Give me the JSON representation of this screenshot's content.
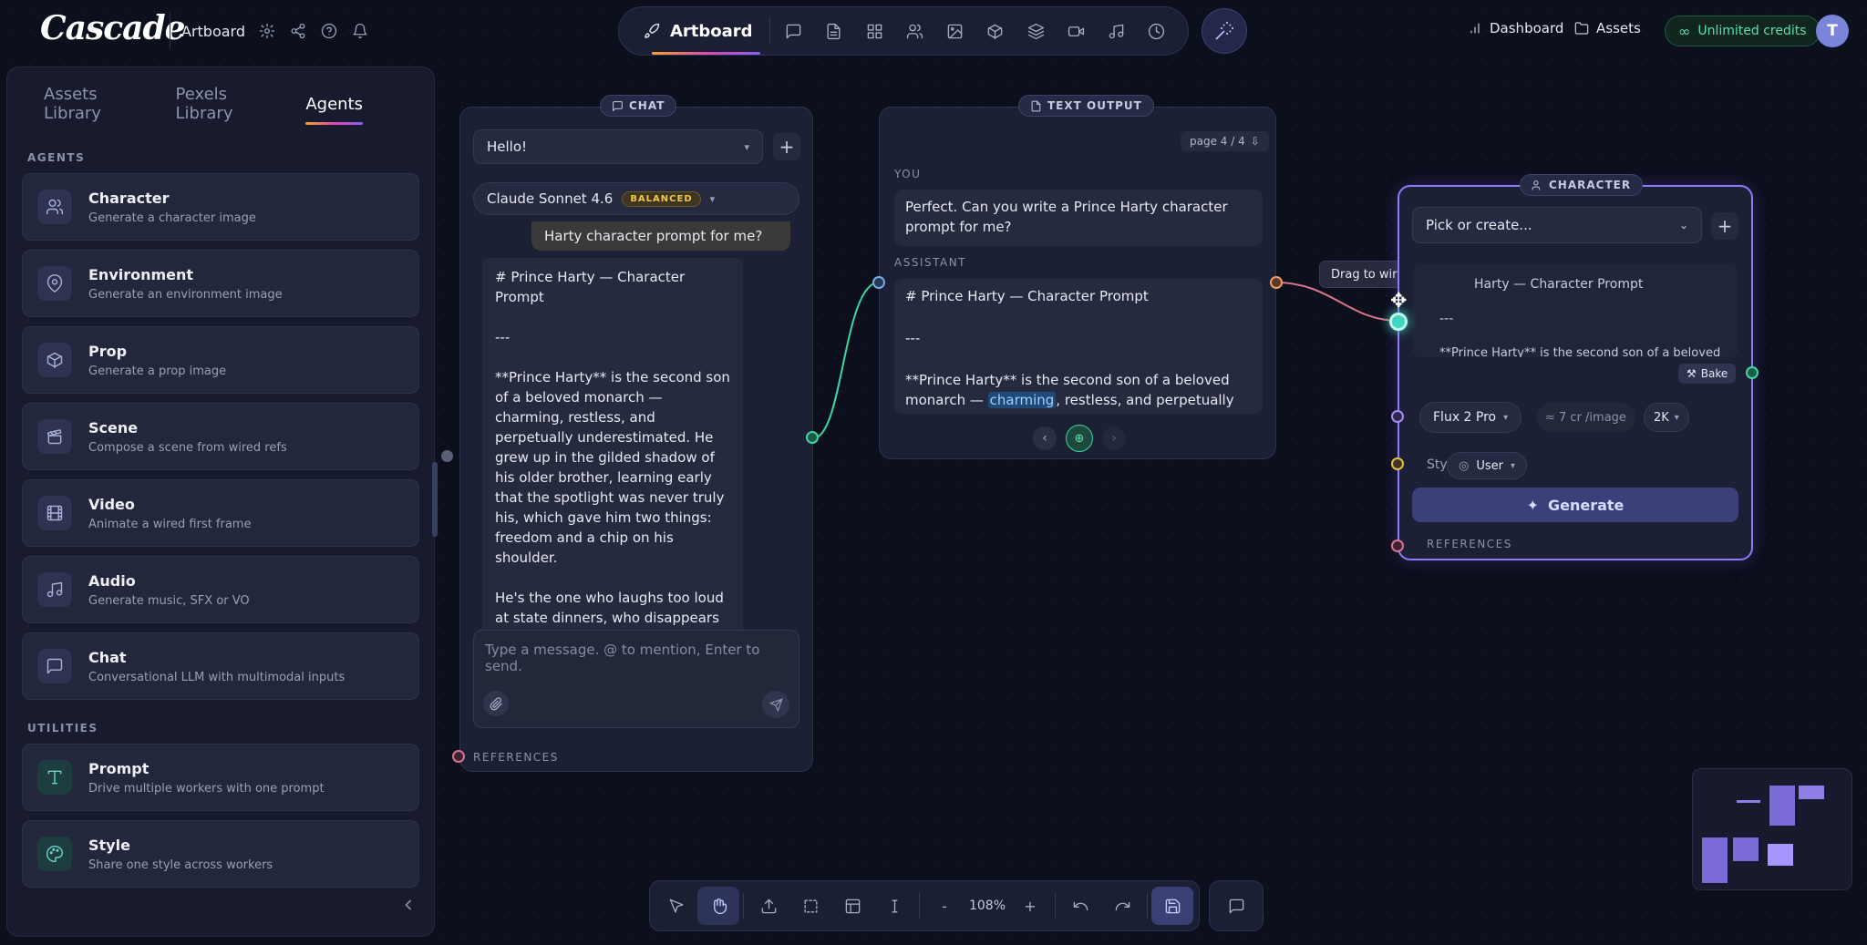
{
  "app": {
    "logo": "Cascade",
    "project_name": "Artboard"
  },
  "toolbar": {
    "active_tool": "Artboard"
  },
  "header": {
    "dashboard": "Dashboard",
    "assets": "Assets",
    "credits": "Unlimited credits",
    "avatar": "T"
  },
  "sidebar": {
    "tabs": [
      "Assets Library",
      "Pexels Library",
      "Agents"
    ],
    "agents_heading": "AGENTS",
    "agents": [
      {
        "name": "Character",
        "desc": "Generate a character image",
        "icon": "users-icon"
      },
      {
        "name": "Environment",
        "desc": "Generate an environment image",
        "icon": "map-pin-icon"
      },
      {
        "name": "Prop",
        "desc": "Generate a prop image",
        "icon": "cube-icon"
      },
      {
        "name": "Scene",
        "desc": "Compose a scene from wired refs",
        "icon": "clapper-icon"
      },
      {
        "name": "Video",
        "desc": "Animate a wired first frame",
        "icon": "film-icon"
      },
      {
        "name": "Audio",
        "desc": "Generate music, SFX or VO",
        "icon": "music-icon"
      },
      {
        "name": "Chat",
        "desc": "Conversational LLM with multimodal inputs",
        "icon": "chat-icon"
      }
    ],
    "utilities_heading": "UTILITIES",
    "utilities": [
      {
        "name": "Prompt",
        "desc": "Drive multiple workers with one prompt",
        "icon": "text-icon"
      },
      {
        "name": "Style",
        "desc": "Share one style across workers",
        "icon": "palette-icon"
      }
    ]
  },
  "chat_node": {
    "badge": "CHAT",
    "session": "Hello!",
    "model": "Claude Sonnet 4.6",
    "model_badge": "BALANCED",
    "user_msg": "Harty character prompt for me?",
    "assistant_msg": "# Prince Harty — Character Prompt\n\n---\n\n**Prince Harty** is the second son of a beloved monarch — charming, restless, and perpetually underestimated. He grew up in the gilded shadow of his older brother, learning early that the spotlight was never truly his, which gave him two things: freedom and a chip on his shoulder.\n\nHe's the one who laughs too loud at state dinners, who disappears from royal events to smoke on the garden terrace with the kitchen",
    "input_placeholder": "Type a message. @ to mention, Enter to send.",
    "references": "REFERENCES"
  },
  "text_output_node": {
    "badge": "TEXT OUTPUT",
    "page": "page 4 / 4",
    "you_label": "YOU",
    "you_msg": "Perfect. Can you write a Prince Harty character prompt for me?",
    "assistant_label": "ASSISTANT",
    "assistant_title": "# Prince Harty — Character Prompt",
    "assistant_rule": "---",
    "assistant_before": "**Prince Harty** is the second son of a beloved monarch — ",
    "assistant_highlight": "charming",
    "assistant_after": ", restless, and perpetually"
  },
  "tooltip": "Drag to wire into Prompt",
  "character_node": {
    "badge": "CHARACTER",
    "picker": "Pick or create...",
    "prompt_preview": "Harty — Character Prompt",
    "prompt_rule": "---",
    "prompt_line3": "**Prince Harty** is the second son of a beloved",
    "bake": "Bake",
    "model": "Flux 2 Pro",
    "cost": "≈ 7 cr /image",
    "resolution": "2K",
    "style_label": "Style",
    "style_value": "User",
    "generate": "Generate",
    "references": "REFERENCES"
  },
  "zoom": "108%",
  "colors": {
    "accent": "#8b5cf6",
    "wire_green": "#3fd6a0",
    "wire_orange": "#f29a6a",
    "credits_green": "#5fe0a9"
  }
}
